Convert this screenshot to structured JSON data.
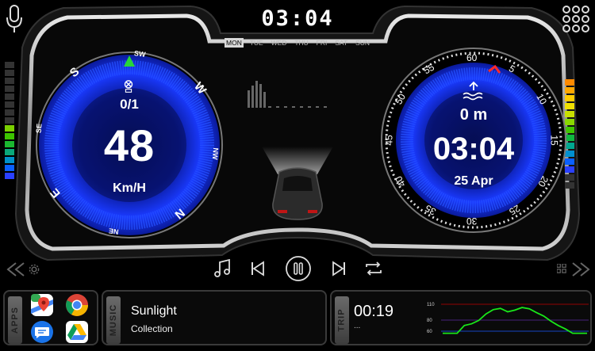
{
  "header": {
    "time": "03:04",
    "days": [
      "MON",
      "TUE",
      "WED",
      "THU",
      "FRI",
      "SAT",
      "SUN"
    ],
    "active_day": "MON",
    "mic_icon": "mic-icon",
    "menu_icon": "apps-grid-icon"
  },
  "speedometer": {
    "speed": "48",
    "unit": "Km/H",
    "gear_ratio": "0/1",
    "compass_labels": [
      "SW",
      "W",
      "NW",
      "N",
      "NE",
      "E",
      "SE",
      "S"
    ],
    "gps_icon": "gps-off-icon",
    "heading_icon": "heading-arrow-icon"
  },
  "right_gauge": {
    "altitude": "0 m",
    "time": "03:04",
    "date": "25 Apr",
    "ticks": [
      "60",
      "5",
      "10",
      "15",
      "20",
      "25",
      "30",
      "35",
      "40",
      "45",
      "50",
      "55"
    ],
    "altitude_icon": "altitude-water-icon"
  },
  "media": {
    "buttons": [
      "music-note-icon",
      "previous-icon",
      "pause-icon",
      "next-icon",
      "repeat-icon"
    ],
    "left_nav": "double-chevron-left-icon",
    "right_nav": "double-chevron-right-icon",
    "settings_icon": "settings-gear-icon",
    "small_grid_icon": "small-grid-icon"
  },
  "dock": {
    "apps_label": "APPS",
    "music_label": "MUSIC",
    "trip_label": "TRIP",
    "apps": [
      "google-maps-icon",
      "chrome-icon",
      "messages-icon",
      "google-drive-icon"
    ],
    "song_title": "Sunlight",
    "song_album": "Collection",
    "trip_time": "00:19",
    "trip_sub": "...",
    "chart_ticks": [
      "110",
      "80",
      "60"
    ]
  },
  "colors": {
    "gauge_blue": "#1a2fd0",
    "gauge_dark": "#0a1060",
    "frame": "#bfbfbf",
    "accent_red": "#ff2a2a",
    "chart_green": "#19e619"
  },
  "chart_data": {
    "type": "line",
    "x": [
      0,
      1,
      2,
      3,
      4,
      5,
      6,
      7,
      8,
      9,
      10,
      11,
      12,
      13,
      14,
      15,
      16,
      17,
      18,
      19,
      20
    ],
    "y": [
      40,
      40,
      40,
      58,
      62,
      70,
      85,
      95,
      98,
      90,
      94,
      100,
      97,
      88,
      80,
      68,
      58,
      50,
      40,
      40,
      40
    ],
    "ylim": [
      30,
      115
    ],
    "yticks": [
      "110",
      "80",
      "60"
    ]
  }
}
